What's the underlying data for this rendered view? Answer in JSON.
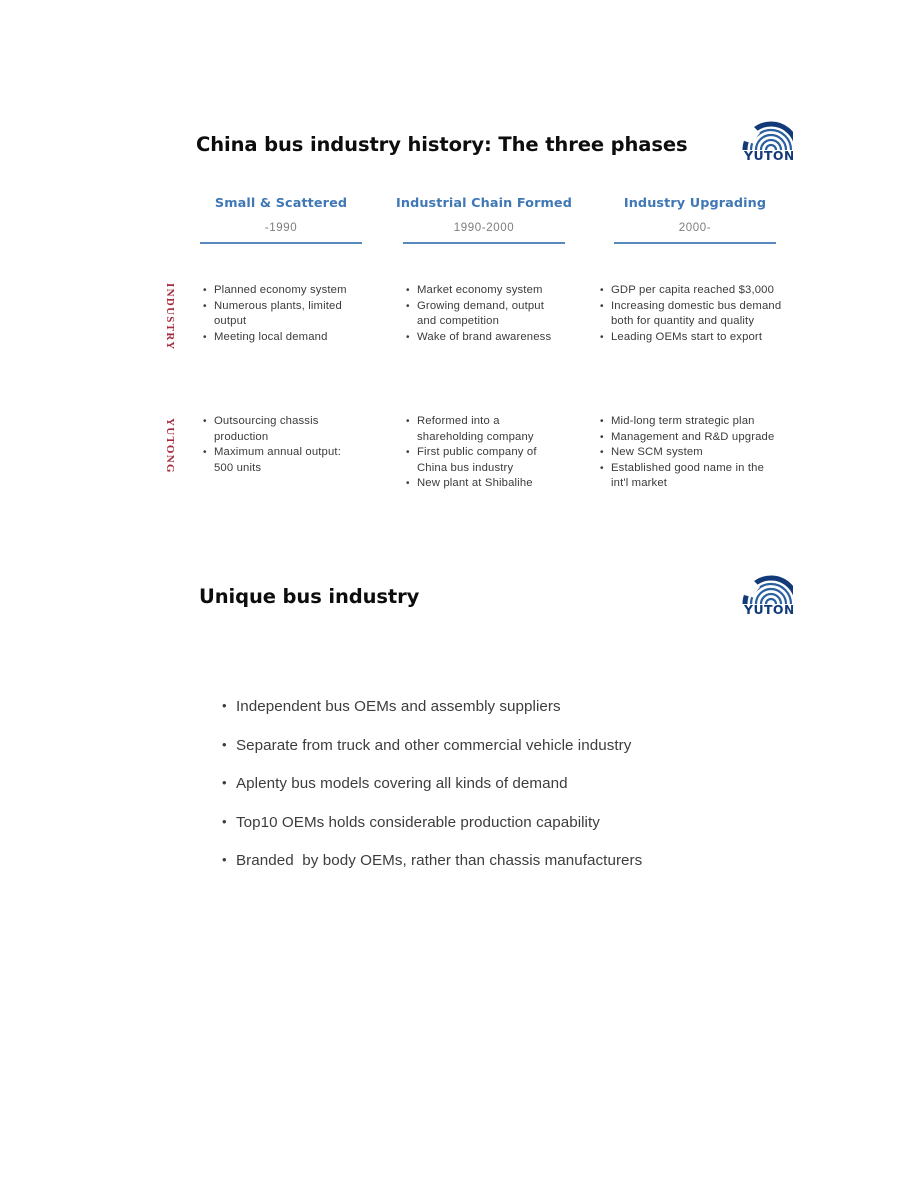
{
  "slide1": {
    "title": "China bus industry history: The three phases",
    "logo": {
      "wordmark": "YUTONG",
      "brand_color": "#123a79"
    },
    "phases": [
      {
        "name": "Small & Scattered",
        "period": "-1990"
      },
      {
        "name": "Industrial Chain Formed",
        "period": "1990-2000"
      },
      {
        "name": "Industry Upgrading",
        "period": "2000-"
      }
    ],
    "rows": [
      {
        "label": "INDUSTRY",
        "cells": [
          {
            "bullets": [
              "Planned economy system",
              "Numerous plants, limited\noutput",
              "Meeting local demand"
            ]
          },
          {
            "bullets": [
              "Market economy system",
              "Growing demand, output\nand competition",
              "Wake of brand awareness"
            ]
          },
          {
            "bullets": [
              "GDP per capita reached $3,000",
              "Increasing domestic bus demand\nboth for quantity and quality",
              "Leading OEMs start to export"
            ]
          }
        ]
      },
      {
        "label": "YUTONG",
        "cells": [
          {
            "bullets": [
              "Outsourcing chassis\nproduction",
              "Maximum annual output:\n500 units"
            ]
          },
          {
            "bullets": [
              "Reformed into a\nshareholding company",
              "First public company of\nChina bus industry",
              "New plant at Shibalihe"
            ]
          },
          {
            "bullets": [
              "Mid-long term strategic plan",
              "Management and R&D upgrade",
              "New SCM system",
              "Established good name in the\nint'l market"
            ]
          }
        ]
      }
    ]
  },
  "slide2": {
    "title": "Unique bus industry",
    "logo": {
      "wordmark": "YUTONG",
      "brand_color": "#123a79"
    },
    "bullets": [
      "Independent bus OEMs and assembly suppliers",
      "Separate from truck and other commercial vehicle industry",
      "Aplenty bus models covering all kinds of demand",
      "Top10 OEMs holds considerable production capability",
      "Branded  by body OEMs, rather than chassis manufacturers"
    ]
  }
}
